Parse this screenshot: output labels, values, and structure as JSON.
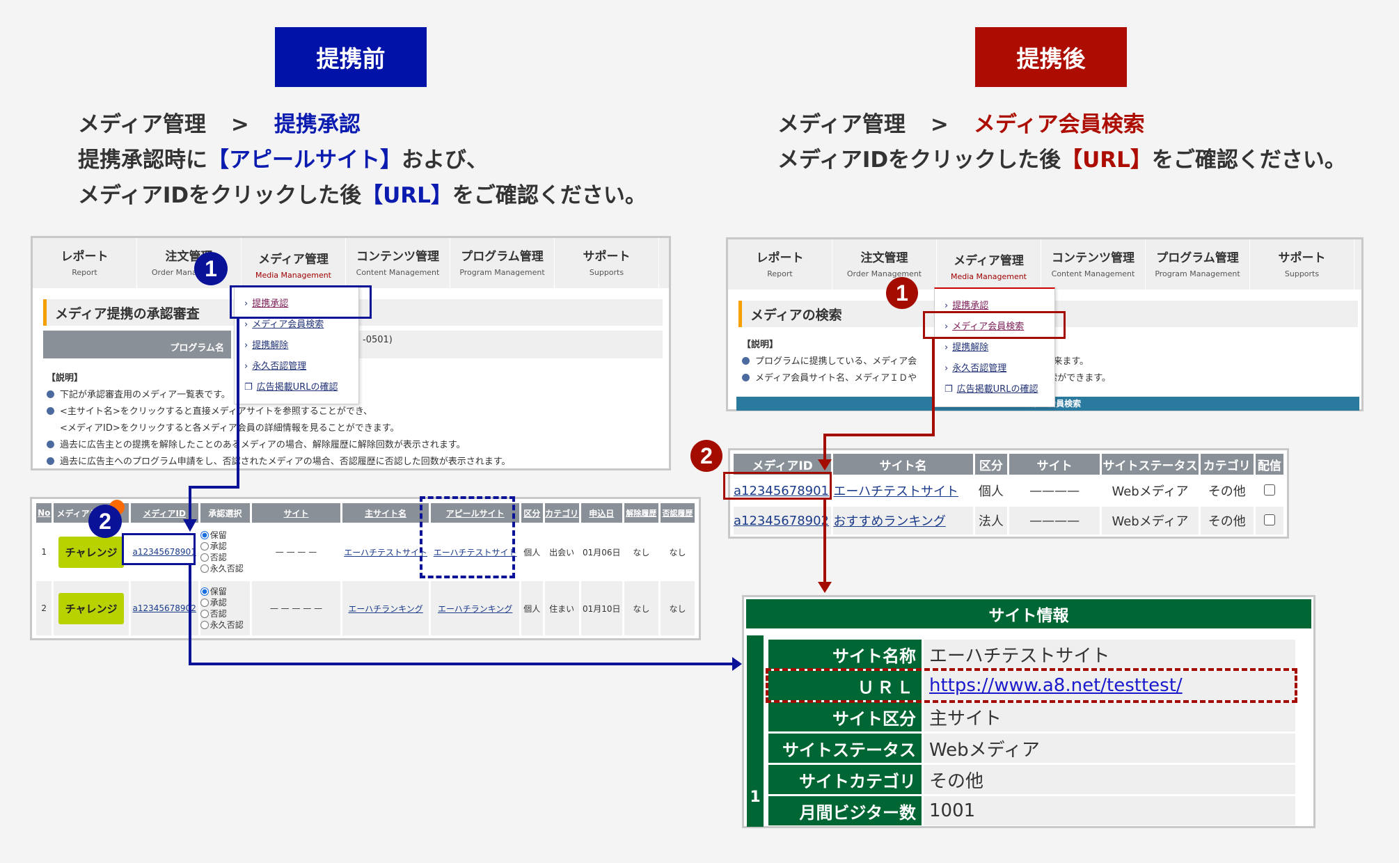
{
  "before": {
    "tag": "提携前",
    "breadcrumb_parent": "メディア管理",
    "breadcrumb_sep": ">",
    "breadcrumb_current": "提携承認",
    "line2_a": "提携承認時に",
    "line2_highlight": "【アピールサイト】",
    "line2_b": "および、",
    "line3_a": "メディアIDをクリックした後",
    "line3_highlight": "【URL】",
    "line3_b": "をご確認ください。",
    "colors": {
      "accent": "#0012a8"
    }
  },
  "after": {
    "tag": "提携後",
    "breadcrumb_parent": "メディア管理",
    "breadcrumb_sep": ">",
    "breadcrumb_current": "メディア会員検索",
    "line2_a": "メディアIDをクリックした後",
    "line2_highlight": "【URL】",
    "line2_b": "をご確認ください。",
    "colors": {
      "accent": "#ad0c00"
    }
  },
  "nav": [
    {
      "jp": "レポート",
      "en": "Report"
    },
    {
      "jp": "注文管理",
      "en": "Order Management"
    },
    {
      "jp": "メディア管理",
      "en": "Media Management"
    },
    {
      "jp": "コンテンツ管理",
      "en": "Content Management"
    },
    {
      "jp": "プログラム管理",
      "en": "Program Management"
    },
    {
      "jp": "サポート",
      "en": "Supports"
    }
  ],
  "dropdown": [
    {
      "icon": "chevron-right-icon",
      "label": "提携承認"
    },
    {
      "icon": "chevron-right-icon",
      "label": "メディア会員検索"
    },
    {
      "icon": "chevron-right-icon",
      "label": "提携解除"
    },
    {
      "icon": "chevron-right-icon",
      "label": "永久否認管理"
    },
    {
      "icon": "window-icon",
      "label": "広告掲載URLの確認"
    }
  ],
  "badges": {
    "one": "1",
    "two": "2"
  },
  "left_panel": {
    "section_title": "メディア提携の承認審査",
    "program_label": "プログラム名",
    "program_value_partial": "-0501)",
    "program_value_prefix": "(",
    "desc_heading": "【説明】",
    "desc": [
      "下記が承認審査用のメディア一覧表です。",
      "<主サイト名>をクリックすると直接メディアサイトを参照することができ、",
      "<メディアID>をクリックすると各メディア会員の詳細情報を見ることができます。",
      "過去に広告主との提携を解除したことのあるメディアの場合、解除履歴に解除回数が表示されます。",
      "過去に広告主へのプログラム申請をし、否認されたメディアの場合、否認履歴に否認した回数が表示されます。"
    ],
    "table": {
      "headers": [
        "No",
        "メディアランク",
        "メディアID",
        "承認選択",
        "サイト",
        "主サイト名",
        "アピールサイト",
        "区分",
        "カテゴリ",
        "申込日",
        "解除履歴",
        "否認履歴"
      ],
      "radio_options": [
        "保留",
        "承認",
        "否認",
        "永久否認"
      ],
      "rows": [
        {
          "no": "1",
          "rank": "チャレンジ",
          "media_id": "a12345678901",
          "selected": "保留",
          "site": "— — — —",
          "main_site": "エーハチテストサイト",
          "appeal_site": "エーハチテストサイト",
          "kubun": "個人",
          "category": "出会い",
          "date": "01月06日",
          "cancel_hist": "なし",
          "deny_hist": "なし"
        },
        {
          "no": "2",
          "rank": "チャレンジ",
          "media_id": "a12345678902",
          "selected": "保留",
          "site": "— — — — —",
          "main_site": "エーハチランキング",
          "appeal_site": "エーハチランキング",
          "kubun": "個人",
          "category": "住まい",
          "date": "01月10日",
          "cancel_hist": "なし",
          "deny_hist": "なし"
        }
      ]
    }
  },
  "right_panel": {
    "section_title": "メディアの検索",
    "desc_heading": "【説明】",
    "desc": [
      "プログラムに提携している、メディア会",
      "が出来ます。",
      "メディア会員サイト名、メディアＩＤや",
      "別に検索ができます。"
    ],
    "search_bar": "メディア会員検索",
    "table": {
      "headers": [
        "メディアID",
        "サイト名",
        "区分",
        "サイト",
        "サイトステータス",
        "カテゴリ",
        "配信"
      ],
      "rows": [
        {
          "media_id": "a12345678901",
          "site_name": "エーハチテストサイト",
          "kubun": "個人",
          "site": "————",
          "status": "Webメディア",
          "category": "その他",
          "checked": false
        },
        {
          "media_id": "a12345678902",
          "site_name": "おすすめランキング",
          "kubun": "法人",
          "site": "————",
          "status": "Webメディア",
          "category": "その他",
          "checked": false
        }
      ]
    }
  },
  "site_info": {
    "title": "サイト情報",
    "index": "1",
    "rows": [
      {
        "label": "サイト名称",
        "value": "エーハチテストサイト"
      },
      {
        "label": "ＵＲＬ",
        "value": "https://www.a8.net/testtest/",
        "link": true
      },
      {
        "label": "サイト区分",
        "value": "主サイト"
      },
      {
        "label": "サイトステータス",
        "value": "Webメディア"
      },
      {
        "label": "サイトカテゴリ",
        "value": "その他"
      },
      {
        "label": "月間ビジター数",
        "value": "1001"
      }
    ]
  }
}
